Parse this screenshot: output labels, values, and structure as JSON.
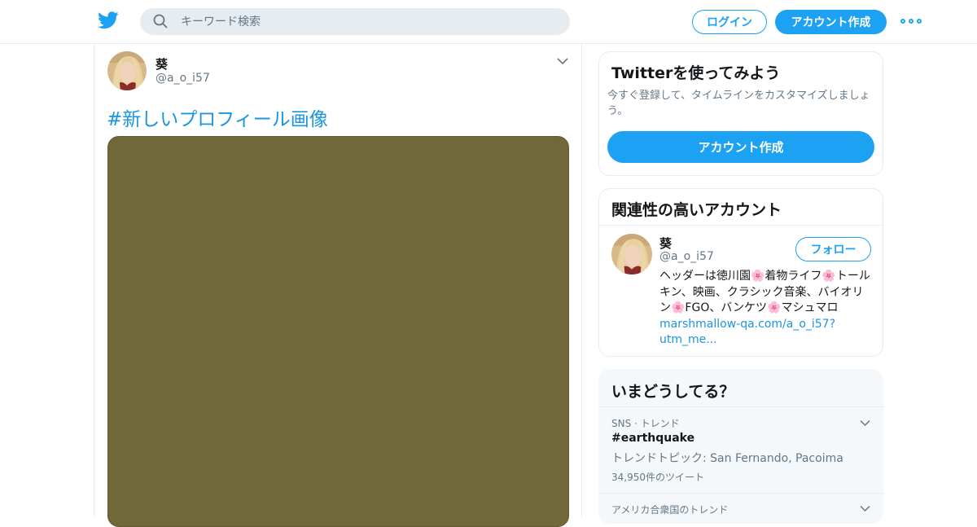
{
  "topbar": {
    "logo_icon": "twitter-bird-icon",
    "search_placeholder": "キーワード検索",
    "login_label": "ログイン",
    "signup_label": "アカウント作成",
    "more_icon": "more-dots-icon"
  },
  "tweet": {
    "display_name": "葵",
    "handle": "@a_o_i57",
    "hashtag_text": "#新しいプロフィール画像",
    "media_color": "#71683a"
  },
  "signup_card": {
    "title": "Twitterを使ってみよう",
    "description": "今すぐ登録して、タイムラインをカスタマイズしましょう。",
    "button_label": "アカウント作成"
  },
  "related_card": {
    "title": "関連性の高いアカウント",
    "account": {
      "display_name": "葵",
      "handle": "@a_o_i57",
      "follow_label": "フォロー",
      "bio_text": "ヘッダーは徳川園🌸着物ライフ🌸トールキン、映画、クラシック音楽、バイオリン🌸FGO、バンケツ🌸マシュマロ",
      "bio_link": "marshmallow-qa.com/a_o_i57?utm_me..."
    }
  },
  "trends_card": {
    "title": "いまどうしてる？",
    "trends": [
      {
        "context": "SNS · トレンド",
        "name": "#earthquake",
        "description": "トレンドトピック: San Fernando, Pacoima",
        "count": "34,950件のツイート"
      },
      {
        "context": "アメリカ合衆国のトレンド"
      }
    ]
  },
  "colors": {
    "accent": "#1da1f2",
    "link": "#1b95e0",
    "secondary_text": "#657786"
  }
}
